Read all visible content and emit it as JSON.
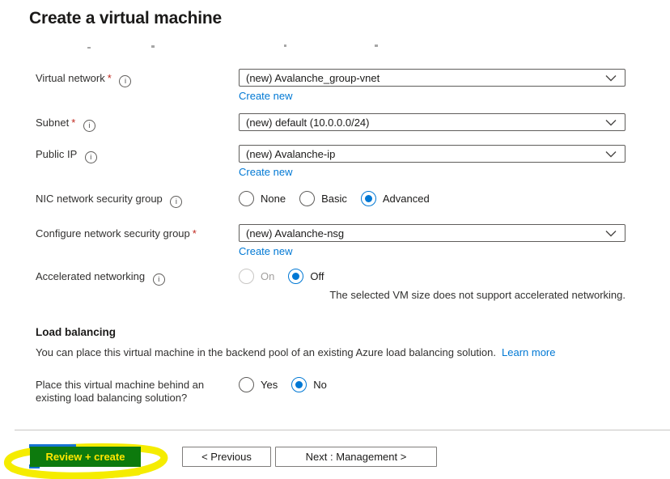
{
  "page": {
    "title": "Create a virtual machine"
  },
  "colors": {
    "link": "#0078d4",
    "radio_selected": "#0078d4",
    "required_marker": "#c0281e",
    "review_button_bg": "#0d7a0d",
    "review_button_text": "#ffe600",
    "highlight_yellow": "#f5ec00",
    "artifact_blue": "#1673d1"
  },
  "form": {
    "required_marker": "*",
    "info_glyph": "i",
    "rows": [
      {
        "label": "Virtual network",
        "required": true,
        "info": true,
        "type": "select",
        "value": "(new) Avalanche_group-vnet",
        "create_new": "Create new"
      },
      {
        "label": "Subnet",
        "required": true,
        "info": true,
        "type": "select",
        "value": "(new) default (10.0.0.0/24)"
      },
      {
        "label": "Public IP",
        "required": false,
        "info": true,
        "type": "select",
        "value": "(new) Avalanche-ip",
        "create_new": "Create new"
      },
      {
        "label": "NIC network security group",
        "required": false,
        "info": true,
        "type": "radio",
        "options": [
          {
            "label": "None",
            "state": "unselected"
          },
          {
            "label": "Basic",
            "state": "unselected"
          },
          {
            "label": "Advanced",
            "state": "selected"
          }
        ]
      },
      {
        "label": "Configure network security group",
        "required": true,
        "info": false,
        "type": "select",
        "value": "(new) Avalanche-nsg",
        "create_new": "Create new"
      },
      {
        "label": "Accelerated networking",
        "required": false,
        "info": true,
        "type": "radio",
        "options": [
          {
            "label": "On",
            "state": "disabled"
          },
          {
            "label": "Off",
            "state": "selected"
          }
        ],
        "note": "The selected VM size does not support accelerated networking."
      }
    ]
  },
  "load_balancing": {
    "heading": "Load balancing",
    "description": "You can place this virtual machine in the backend pool of an existing Azure load balancing solution.",
    "learn_more": "Learn more",
    "question": "Place this virtual machine behind an existing load balancing solution?",
    "options": [
      {
        "label": "Yes",
        "state": "unselected"
      },
      {
        "label": "No",
        "state": "selected"
      }
    ]
  },
  "footer": {
    "review_create": "Review + create",
    "previous": "< Previous",
    "next": "Next : Management >"
  }
}
